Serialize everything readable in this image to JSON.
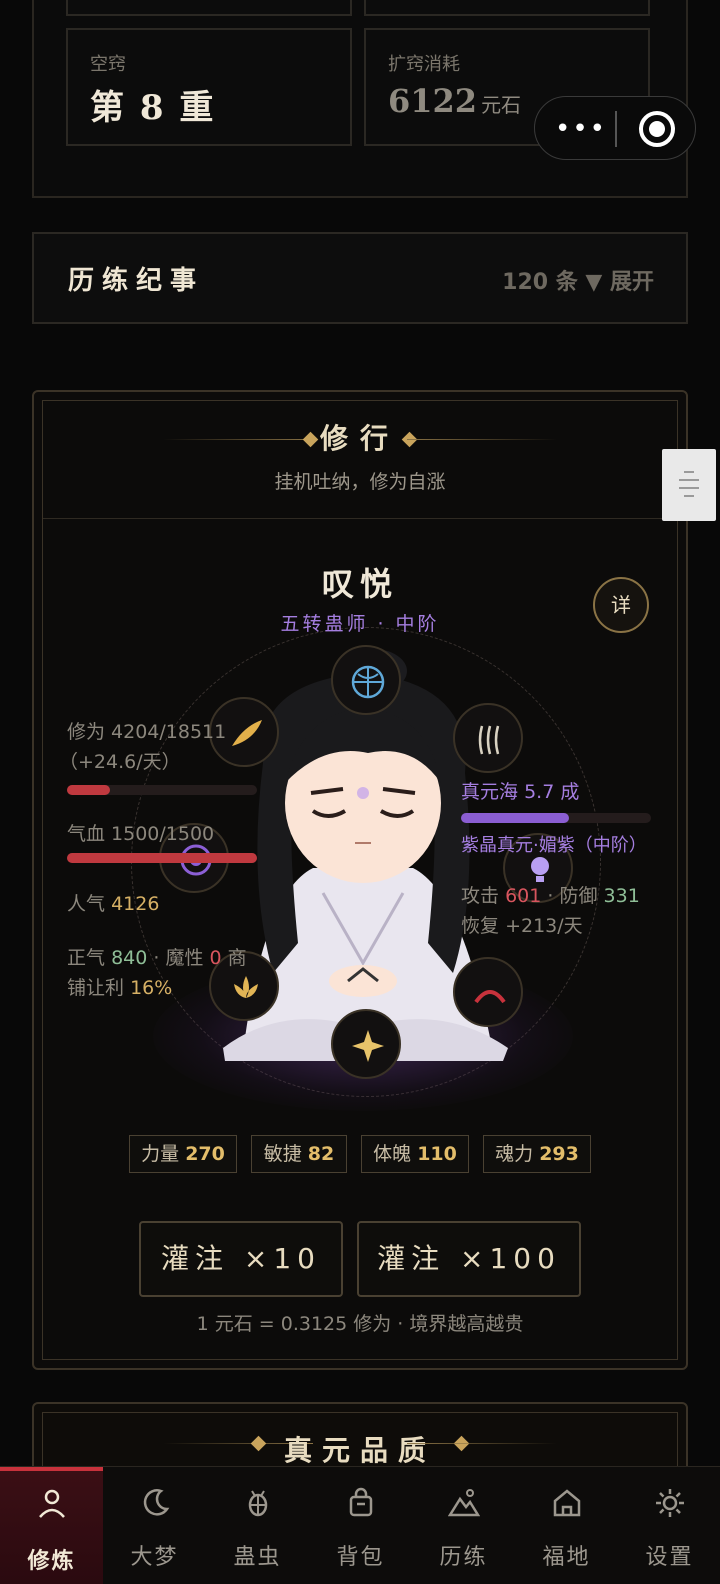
{
  "top_panel": {
    "cell1_label": "空窍",
    "cell1_value": "第 8 重",
    "cell2_label": "扩窍消耗",
    "cell2_value": "6122",
    "cell2_unit": "元石",
    "cell_partial_glyph": "·"
  },
  "capsule": {
    "more_icon": "more-dots-icon",
    "close_icon": "target-icon",
    "more_glyph": "•••"
  },
  "chronicle": {
    "title": "历练纪事",
    "count": "120 条 ▼ 展开"
  },
  "cultivation": {
    "title": "修行",
    "subtitle": "挂机吐纳，修为自涨",
    "name": "叹悦",
    "rank": "五转蛊师 · 中阶",
    "detail_label": "详",
    "cultivation_label": "修为 4204/18511",
    "cultivation_rate": "（+24.6/天）",
    "cultivation_progress": 0.227,
    "hp_label": "气血 1500/1500",
    "hp_progress": 1.0,
    "popularity_label": "人气",
    "popularity_value": "4126",
    "righteous_label": "正气",
    "righteous_value": "840",
    "demonic_label": "魔性",
    "demonic_value": "0",
    "shop_label": "商",
    "discount_label": "铺让利",
    "discount_value": "16%",
    "essence_sea_label": "真元海",
    "essence_sea_value": "5.7 成",
    "essence_progress": 0.57,
    "essence_type": "紫晶真元·媚紫（中阶）",
    "attack_label": "攻击",
    "attack_value": "601",
    "defense_label": "防御",
    "defense_value": "331",
    "recover_label": "恢复",
    "recover_value": "+213/天",
    "attrs": [
      {
        "label": "力量",
        "value": "270"
      },
      {
        "label": "敏捷",
        "value": "82"
      },
      {
        "label": "体魄",
        "value": "110"
      },
      {
        "label": "魂力",
        "value": "293"
      }
    ],
    "pour10": "灌注 ×10",
    "pour100": "灌注 ×100",
    "rate_note": "1 元石 = 0.3125 修为 · 境界越高越贵"
  },
  "next_section": {
    "title": "真元品质"
  },
  "nav": [
    {
      "label": "修炼",
      "icon": "person-icon",
      "active": true
    },
    {
      "label": "大梦",
      "icon": "moon-icon"
    },
    {
      "label": "蛊虫",
      "icon": "bug-icon"
    },
    {
      "label": "背包",
      "icon": "bag-icon"
    },
    {
      "label": "历练",
      "icon": "mountain-icon"
    },
    {
      "label": "福地",
      "icon": "home-icon"
    },
    {
      "label": "设置",
      "icon": "gear-icon"
    }
  ],
  "colors": {
    "accent": "#c8323c",
    "gold": "#d6b065",
    "purple": "#a57ee0"
  }
}
